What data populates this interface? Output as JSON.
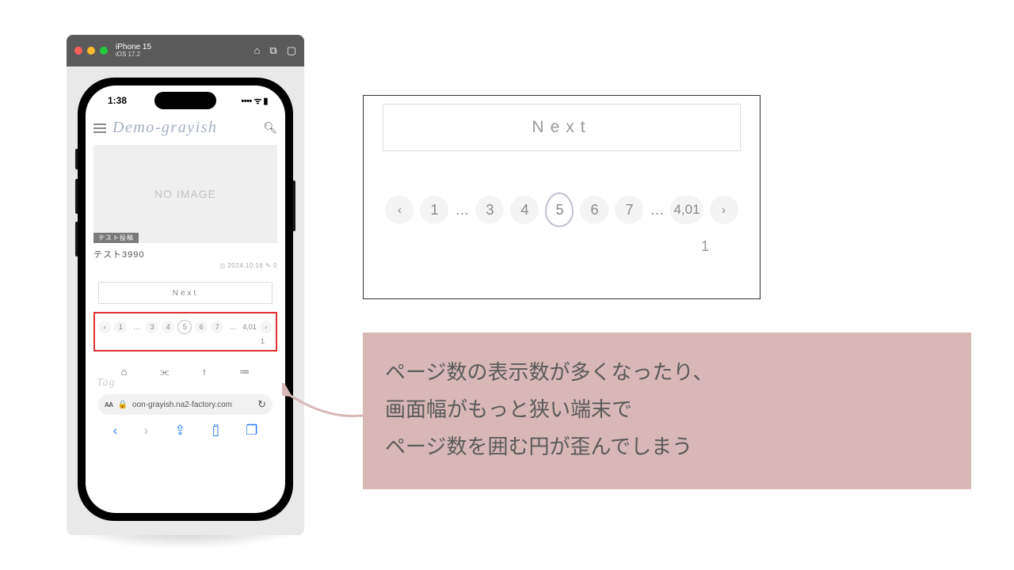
{
  "simulator": {
    "device": "iPhone 15",
    "os": "iOS 17.2"
  },
  "statusbar": {
    "time": "1:38",
    "icons": "•••• ᯤ ▮"
  },
  "app": {
    "logo": "Demo-grayish",
    "no_image": "NO IMAGE",
    "tag": "テスト投稿",
    "post_title": "テスト3990",
    "post_meta": "◷ 2024.10.16 ✎ 0",
    "next_label": "Next",
    "tag_heading": "Tag"
  },
  "pager": {
    "items": [
      "‹",
      "1",
      "…",
      "3",
      "4",
      "5",
      "6",
      "7",
      "…",
      "4,01",
      "›"
    ],
    "overflow": "1",
    "current_index": 5
  },
  "browser": {
    "aa": "AA",
    "lock": "🔒",
    "url": "oon-grayish.na2-factory.com",
    "reload": "↻"
  },
  "zoom": {
    "next_label": "Next",
    "items": [
      "‹",
      "1",
      "…",
      "3",
      "4",
      "5",
      "6",
      "7",
      "…",
      "4,01",
      "›"
    ],
    "overflow": "1",
    "current_index": 5
  },
  "callout": {
    "line1": "ページ数の表示数が多くなったり、",
    "line2": "画面幅がもっと狭い端末で",
    "line3": "ページ数を囲む円が歪んでしまう"
  }
}
